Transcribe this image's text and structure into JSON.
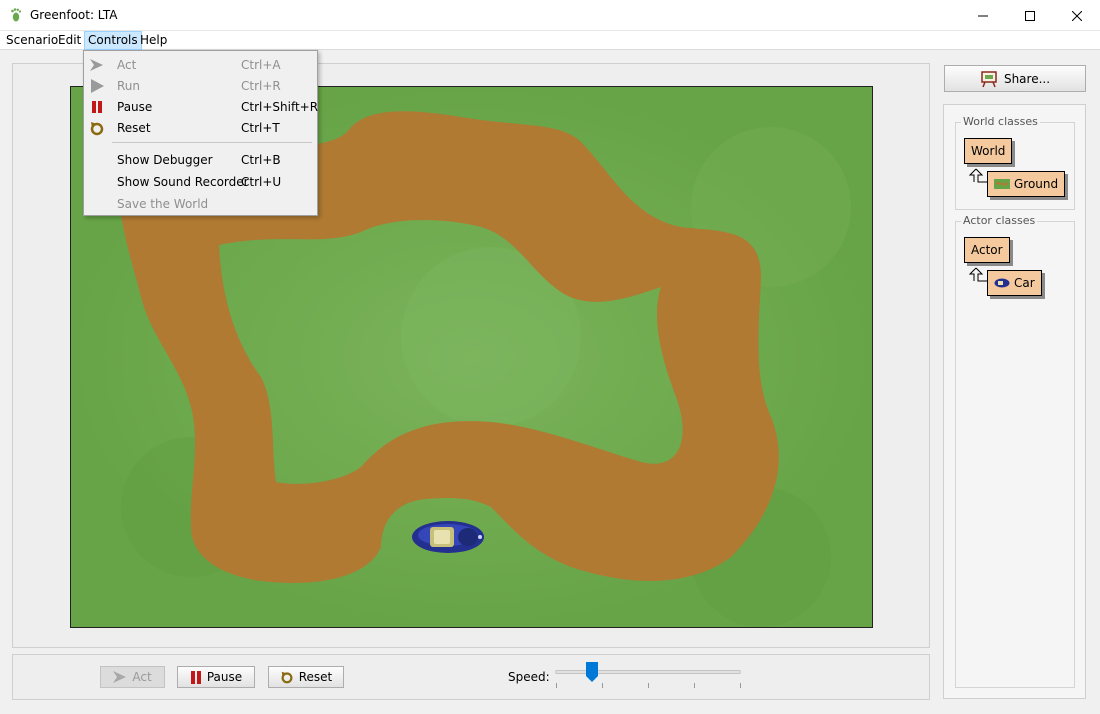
{
  "window": {
    "title": "Greenfoot: LTA"
  },
  "menubar": {
    "items": [
      {
        "label": "Scenario"
      },
      {
        "label": "Edit"
      },
      {
        "label": "Controls"
      },
      {
        "label": "Help"
      }
    ]
  },
  "controls_menu": {
    "items": [
      {
        "label": "Act",
        "shortcut": "Ctrl+A",
        "enabled": false
      },
      {
        "label": "Run",
        "shortcut": "Ctrl+R",
        "enabled": false
      },
      {
        "label": "Pause",
        "shortcut": "Ctrl+Shift+R",
        "enabled": true
      },
      {
        "label": "Reset",
        "shortcut": "Ctrl+T",
        "enabled": true
      },
      {
        "label": "Show Debugger",
        "shortcut": "Ctrl+B",
        "enabled": true
      },
      {
        "label": "Show Sound Recorder",
        "shortcut": "Ctrl+U",
        "enabled": true
      },
      {
        "label": "Save the World",
        "shortcut": "",
        "enabled": false
      }
    ]
  },
  "toolbar": {
    "act_label": "Act",
    "pause_label": "Pause",
    "reset_label": "Reset",
    "speed_label": "Speed:",
    "speed_fraction": 0.2
  },
  "right_panel": {
    "share_label": "Share...",
    "world_group": {
      "title": "World classes",
      "root": "World",
      "child": "Ground"
    },
    "actor_group": {
      "title": "Actor classes",
      "root": "Actor",
      "child": "Car"
    }
  },
  "colors": {
    "grass": "#67a447",
    "track": "#b07a33",
    "accent": "#0078d7",
    "class_box": "#f4c99e",
    "menu_highlight": "#cce8ff"
  }
}
